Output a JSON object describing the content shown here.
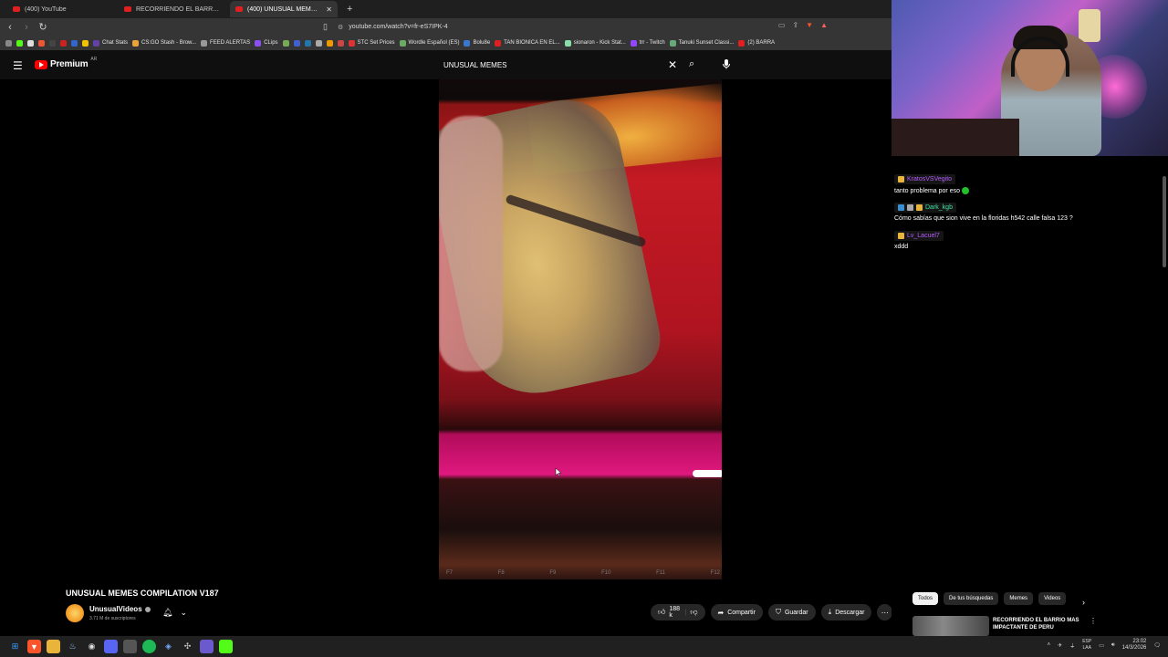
{
  "browser": {
    "tabs": [
      {
        "label": "(400) YouTube",
        "active": false
      },
      {
        "label": "RECORRIENDO EL BARRIO MAS IMP",
        "active": false
      },
      {
        "label": "(400) UNUSUAL MEMES COMPIL",
        "active": true
      }
    ],
    "url": "youtube.com/watch?v=fr-eS7IPK-4",
    "bookmarks": [
      "Chat Stats",
      "CS:GO Stash - Brow...",
      "FEED ALERTAS",
      "CLips",
      "STC Set Prices",
      "Wordle Español (ES)",
      "Bolu8e",
      "TAN BIONICA EN EL...",
      "sionaron - Kick Stat...",
      "trr - Twitch",
      "Tanuki Sunset Classi...",
      "(2) BARRA"
    ]
  },
  "youtube": {
    "logo_text": "Premium",
    "logo_region": "AR",
    "search_value": "UNUSUAL MEMES",
    "video_title": "UNUSUAL MEMES COMPILATION V187",
    "channel_name": "UnusualVideos",
    "subscribers": "3.71 M de suscriptores",
    "likes": "188 k",
    "share_label": "Compartir",
    "save_label": "Guardar",
    "download_label": "Descargar",
    "chips": [
      "Todos",
      "De tus búsquedas",
      "Memes",
      "Videos"
    ],
    "recommended_title": "RECORRIENDO EL BARRIO MAS IMPACTANTE DE PERU"
  },
  "chat": [
    {
      "user": "KratosVSVegito",
      "color": "#b45cff",
      "text": "tanto problema por eso"
    },
    {
      "user": "Dark_kgb",
      "color": "#3fe3a3",
      "text": "Cómo sabías que sion vive en la floridas h542 calle falsa 123 ?"
    },
    {
      "user": "Lv_Lacuel7",
      "color": "#b45cff",
      "text": "xddd"
    }
  ],
  "taskbar": {
    "lang_top": "ESP",
    "lang_bottom": "LAA",
    "time": "23:02",
    "date": "14/3/2026"
  }
}
